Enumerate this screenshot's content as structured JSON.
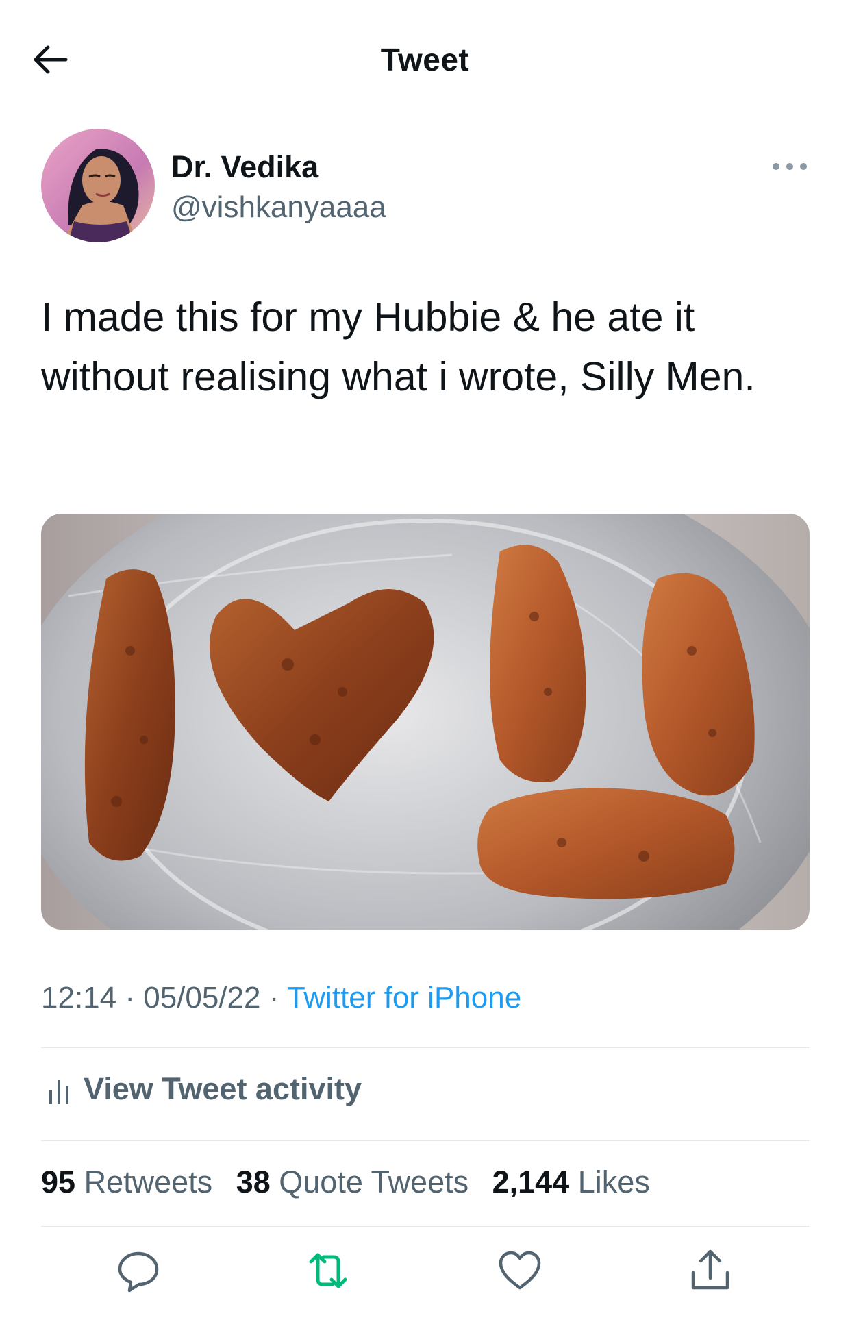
{
  "header": {
    "title": "Tweet",
    "back_icon": "arrow-left-icon"
  },
  "author": {
    "display_name": "Dr. Vedika",
    "handle": "@vishkanyaaaa",
    "more_icon": "more-horizontal-icon"
  },
  "tweet": {
    "text": "I made this for my Hubbie & he ate it without realising what i wrote, Silly Men.",
    "image_alt": "fried cutlets on a steel plate"
  },
  "meta": {
    "time": "12:14",
    "separator": " · ",
    "date": "05/05/22",
    "source": "Twitter for iPhone"
  },
  "activity": {
    "label": "View Tweet activity",
    "icon": "bar-chart-icon"
  },
  "stats": [
    {
      "count": "95",
      "label": "Retweets"
    },
    {
      "count": "38",
      "label": "Quote Tweets"
    },
    {
      "count": "2,144",
      "label": "Likes"
    }
  ],
  "actions": [
    {
      "name": "reply",
      "icon": "reply-icon"
    },
    {
      "name": "retweet",
      "icon": "retweet-icon"
    },
    {
      "name": "like",
      "icon": "heart-icon"
    },
    {
      "name": "share",
      "icon": "share-icon"
    }
  ],
  "colors": {
    "accent": "#1d9bf0",
    "retweet": "#00ba7c",
    "text": "#0f1419",
    "secondary": "#536471",
    "divider": "#e3e7ea"
  }
}
